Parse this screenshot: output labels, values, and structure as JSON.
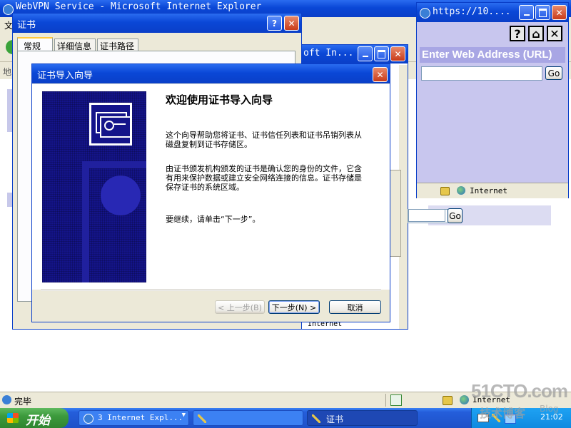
{
  "ie_back": {
    "title": "WebVPN Service - Microsoft Internet Explorer",
    "menu_first_char": "文",
    "address_label": "地",
    "status_text": "完毕",
    "zone_text": "Internet"
  },
  "ie_mid": {
    "title": "oft In...",
    "status_zone": "Internet",
    "go_label": "Go"
  },
  "cert_dialog": {
    "title": "证书",
    "help_label": "?",
    "close_label": "✕",
    "tabs": [
      "常规",
      "详细信息",
      "证书路径"
    ]
  },
  "wizard": {
    "title": "证书导入向导",
    "heading": "欢迎使用证书导入向导",
    "para1": "这个向导帮助您将证书、证书信任列表和证书吊销列表从磁盘复制到证书存储区。",
    "para2": "由证书颁发机构颁发的证书是确认您的身份的文件，它含有用来保护数据或建立安全网络连接的信息。证书存储是保存证书的系统区域。",
    "para3": "要继续，请单击“下一步”。",
    "back_button": "< 上一步(B)",
    "next_button": "下一步(N) >",
    "cancel_button": "取消"
  },
  "mini_ie": {
    "title": "https://10....",
    "help_label": "?",
    "home_label": "⌂",
    "close_label": "✕",
    "enter_label": "Enter Web Address (URL)",
    "url_value": "",
    "go_label": "Go",
    "zone_text": "Internet"
  },
  "taskbar": {
    "start_label": "开始",
    "items": [
      "3 Internet Expl...",
      "",
      "证书"
    ],
    "clock": "21:02"
  },
  "watermark": {
    "main": "51CTO.com",
    "sub": "技术博客",
    "blog": "Blog"
  },
  "colors": {
    "xp_blue": "#0a47d6",
    "dialog_face": "#ece9d8",
    "taskbar": "#245edb",
    "start_green": "#3c9a3c",
    "mini_panel": "#c8c6ee",
    "wizard_art": "#14148a"
  }
}
